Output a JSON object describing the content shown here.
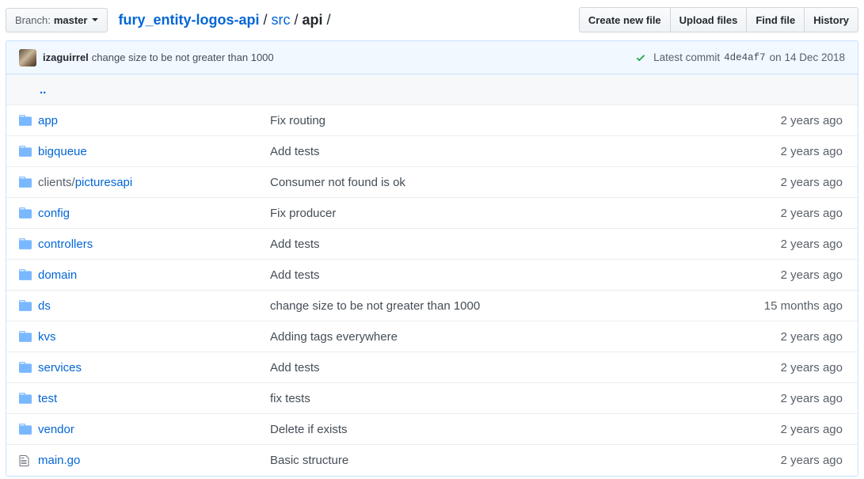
{
  "branch": {
    "prefix": "Branch:",
    "name": "master"
  },
  "breadcrumb": {
    "repo": "fury_entity-logos-api",
    "sep1": "/",
    "dir": "src",
    "sep2": "/",
    "current": "api",
    "sep3": "/"
  },
  "actions": {
    "create": "Create new file",
    "upload": "Upload files",
    "find": "Find file",
    "history": "History"
  },
  "commit": {
    "author": "izaguirrel",
    "message": "change size to be not greater than 1000",
    "latest_label": "Latest commit",
    "sha": "4de4af7",
    "date": "on 14 Dec 2018"
  },
  "parent_dir": "..",
  "files": [
    {
      "prefix": "",
      "name": "app",
      "type": "dir",
      "message": "Fix routing",
      "age": "2 years ago"
    },
    {
      "prefix": "",
      "name": "bigqueue",
      "type": "dir",
      "message": "Add tests",
      "age": "2 years ago"
    },
    {
      "prefix": "clients/",
      "name": "picturesapi",
      "type": "dir",
      "message": "Consumer not found is ok",
      "age": "2 years ago"
    },
    {
      "prefix": "",
      "name": "config",
      "type": "dir",
      "message": "Fix producer",
      "age": "2 years ago"
    },
    {
      "prefix": "",
      "name": "controllers",
      "type": "dir",
      "message": "Add tests",
      "age": "2 years ago"
    },
    {
      "prefix": "",
      "name": "domain",
      "type": "dir",
      "message": "Add tests",
      "age": "2 years ago"
    },
    {
      "prefix": "",
      "name": "ds",
      "type": "dir",
      "message": "change size to be not greater than 1000",
      "age": "15 months ago"
    },
    {
      "prefix": "",
      "name": "kvs",
      "type": "dir",
      "message": "Adding tags everywhere",
      "age": "2 years ago"
    },
    {
      "prefix": "",
      "name": "services",
      "type": "dir",
      "message": "Add tests",
      "age": "2 years ago"
    },
    {
      "prefix": "",
      "name": "test",
      "type": "dir",
      "message": "fix tests",
      "age": "2 years ago"
    },
    {
      "prefix": "",
      "name": "vendor",
      "type": "dir",
      "message": "Delete if exists",
      "age": "2 years ago"
    },
    {
      "prefix": "",
      "name": "main.go",
      "type": "file",
      "message": "Basic structure",
      "age": "2 years ago"
    }
  ],
  "colors": {
    "link": "#0366d6",
    "folder_icon": "#79b8ff",
    "check": "#28a745"
  },
  "icons": {
    "dir": "folder-icon",
    "file": "file-icon",
    "status": "check-icon"
  }
}
